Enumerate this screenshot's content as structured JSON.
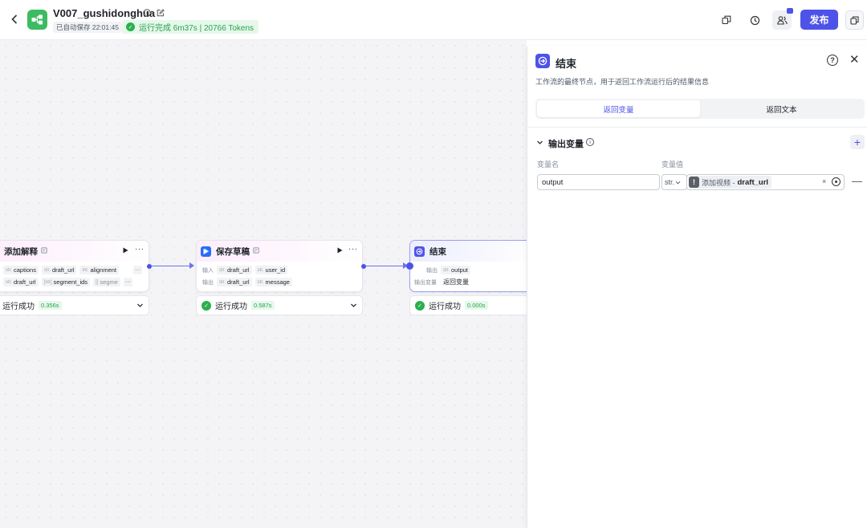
{
  "header": {
    "workflow_name": "V007_gushidonghua",
    "autosave_text": "已自动保存 22:01:45",
    "run_status": "运行完成 6m37s | 20766 Tokens",
    "publish_label": "发布"
  },
  "colors": {
    "accent": "#4d53e8",
    "success": "#2ab04c",
    "logo": "#3dbb62"
  },
  "canvas": {
    "nodes": [
      {
        "title": "添加解释",
        "note_icon": "note-icon",
        "rows": [
          {
            "label": "",
            "vars": [
              {
                "t": "str.",
                "n": "captions"
              },
              {
                "t": "str.",
                "n": "draft_url"
              },
              {
                "t": "int.",
                "n": "alignment"
              }
            ]
          },
          {
            "label": "",
            "vars": [
              {
                "t": "str.",
                "n": "draft_url"
              },
              {
                "t": "[str]",
                "n": "segment_ids"
              },
              {
                "t": "[]",
                "n": "segme"
              }
            ]
          }
        ],
        "status": "运行成功",
        "time": "0.356s"
      },
      {
        "title": "保存草稿",
        "note_icon": "note-icon",
        "rows": [
          {
            "label": "输入",
            "vars": [
              {
                "t": "str.",
                "n": "draft_url"
              },
              {
                "t": "str.",
                "n": "user_id"
              }
            ]
          },
          {
            "label": "输出",
            "vars": [
              {
                "t": "str.",
                "n": "draft_url"
              },
              {
                "t": "str.",
                "n": "message"
              }
            ]
          }
        ],
        "status": "运行成功",
        "time": "0.587s"
      },
      {
        "title": "结束",
        "rows": [
          {
            "label": "输出",
            "vars": [
              {
                "t": "str.",
                "n": "output"
              }
            ]
          },
          {
            "label": "输出变量",
            "text": "返回变量"
          }
        ],
        "status": "运行成功",
        "time": "0.000s"
      }
    ]
  },
  "panel": {
    "title": "结束",
    "description": "工作流的最终节点，用于返回工作流运行后的结果信息",
    "tabs": [
      {
        "label": "返回变量",
        "active": true
      },
      {
        "label": "返回文本",
        "active": false
      }
    ],
    "section_title": "输出变量",
    "col_name": "变量名",
    "col_value": "变量值",
    "var_name_value": "output",
    "var_type": "str.",
    "ref_node": "添加视频 -",
    "ref_var": "draft_url"
  }
}
